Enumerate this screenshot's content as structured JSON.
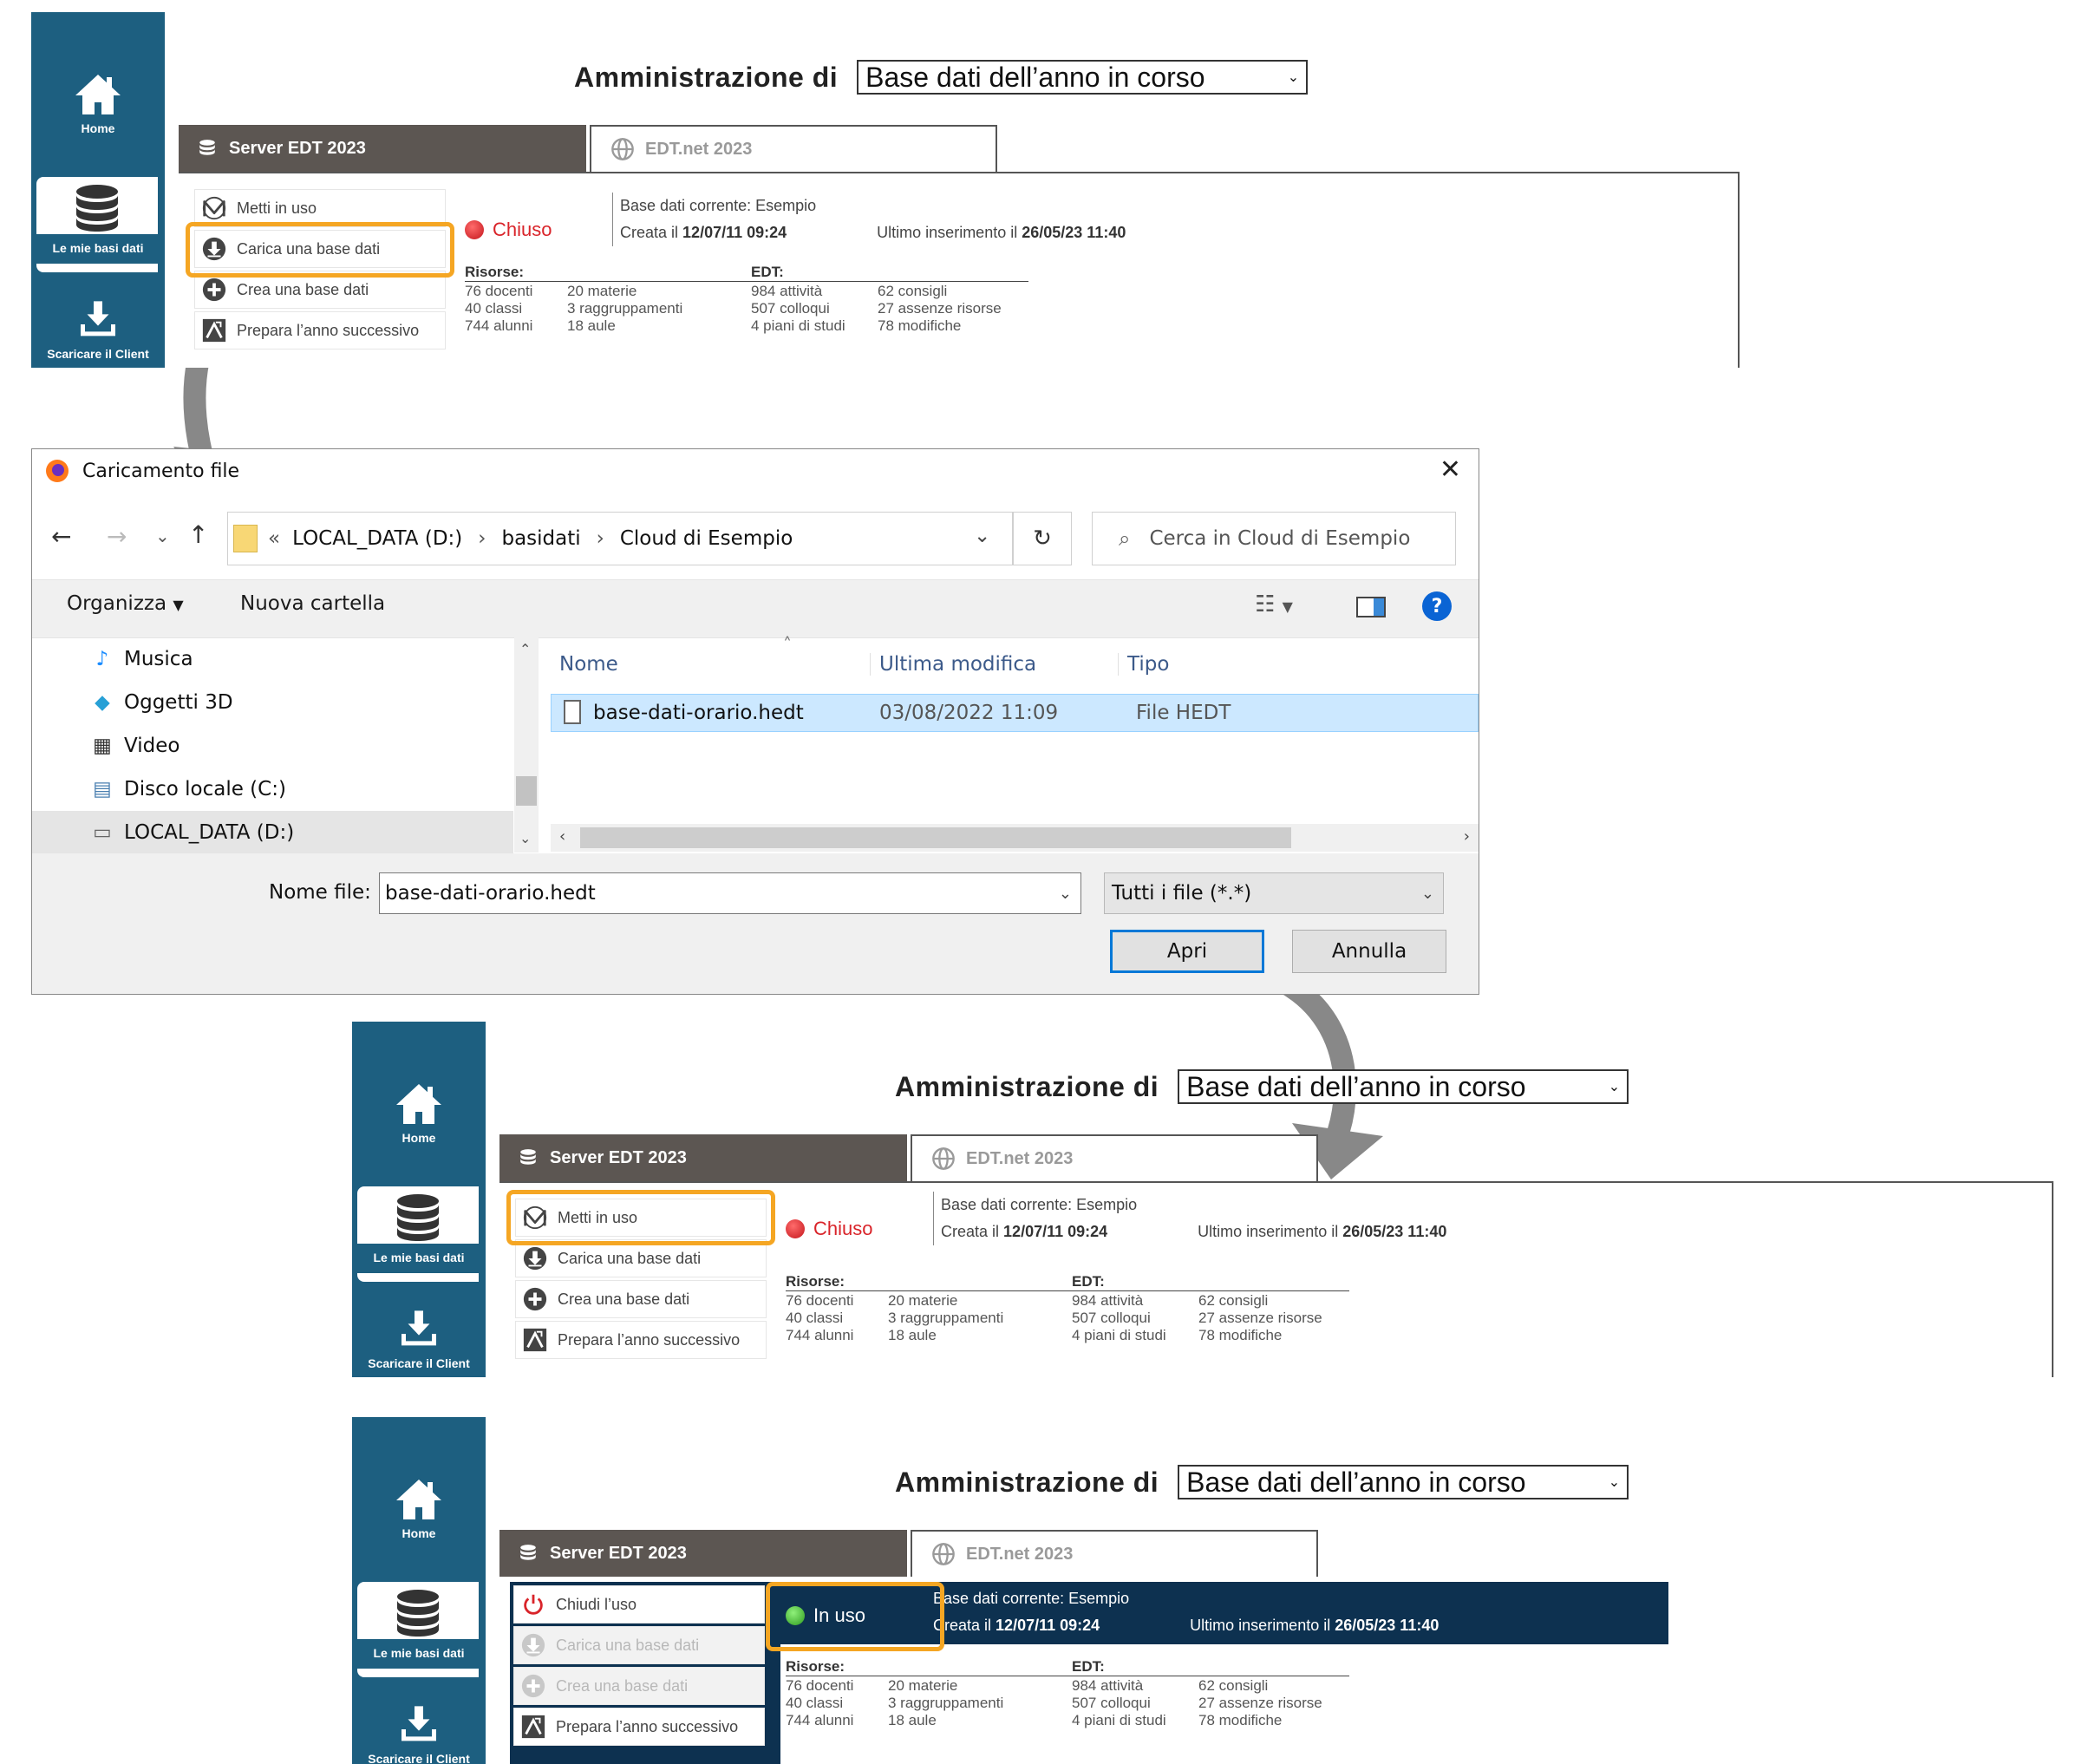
{
  "panel": {
    "sidebar": {
      "home": "Home",
      "databases": "Le mie basi dati",
      "download": "Scaricare il Client"
    },
    "admin_label": "Amministrazione di",
    "admin_select": "Base dati dell’anno in corso",
    "tab_server": "Server EDT 2023",
    "tab_net": "EDT.net 2023",
    "current_db_label": "Base dati corrente: Esempio",
    "created_label": "Creata il",
    "created_value": "12/07/11 09:24",
    "last_insert_label": "Ultimo inserimento il",
    "last_insert_value": "26/05/23 11:40",
    "resources_label": "Risorse:",
    "resources_col1": [
      "76 docenti",
      "40 classi",
      "744 alunni"
    ],
    "resources_col2": [
      "20 materie",
      "3 raggruppamenti",
      "18 aule"
    ],
    "edt_label": "EDT:",
    "edt_col1": [
      "984 attività",
      "507 colloqui",
      "4 piani di studi"
    ],
    "edt_col2": [
      "62 consigli",
      "27 assenze risorse",
      "78 modifiche"
    ]
  },
  "state1": {
    "actions": [
      "Metti in uso",
      "Carica una base dati",
      "Crea una base dati",
      "Prepara l’anno successivo"
    ],
    "status": "Chiuso"
  },
  "state2": {
    "actions": [
      "Metti in uso",
      "Carica una base dati",
      "Crea una base dati",
      "Prepara l’anno successivo"
    ],
    "status": "Chiuso"
  },
  "state3": {
    "actions": [
      "Chiudi l’uso",
      "Carica una base dati",
      "Crea una base dati",
      "Prepara l’anno successivo"
    ],
    "status": "In uso"
  },
  "dialog": {
    "title": "Caricamento file",
    "path": [
      "LOCAL_DATA (D:)",
      "basidati",
      "Cloud di Esempio"
    ],
    "search_placeholder": "Cerca in Cloud di Esempio",
    "organize": "Organizza",
    "new_folder": "Nuova cartella",
    "nav_items": [
      "Musica",
      "Oggetti 3D",
      "Video",
      "Disco locale (C:)",
      "LOCAL_DATA (D:)"
    ],
    "columns": [
      "Nome",
      "Ultima modifica",
      "Tipo"
    ],
    "file": {
      "name": "base-dati-orario.hedt",
      "modified": "03/08/2022 11:09",
      "type": "File HEDT"
    },
    "filename_label": "Nome file:",
    "filename_value": "base-dati-orario.hedt",
    "filetype_value": "Tutti i file (*.*)",
    "open": "Apri",
    "cancel": "Annulla"
  },
  "colors": {
    "sidebar": "#1d5f80",
    "highlight": "#f5a623",
    "closed": "#d9242a",
    "inuse_bg": "#0d3150",
    "dialog_accent": "#0078d7"
  }
}
